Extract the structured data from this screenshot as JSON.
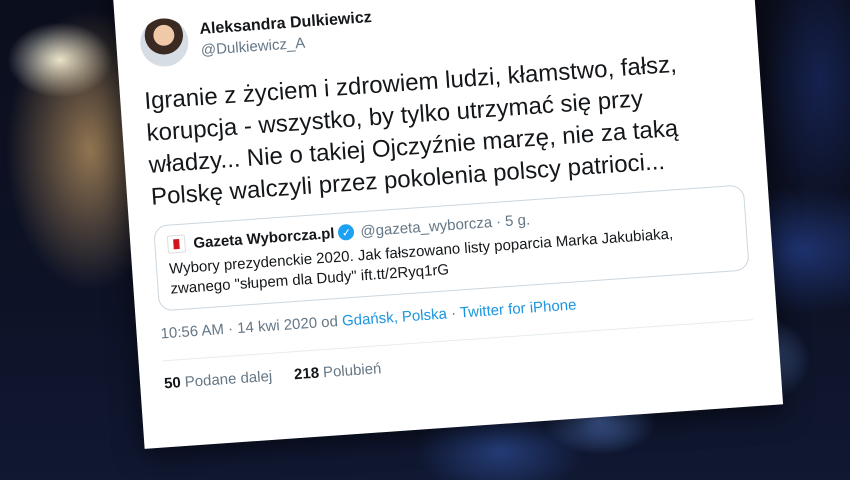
{
  "tweet": {
    "display_name": "Aleksandra Dulkiewicz",
    "handle": "@Dulkiewicz_A",
    "text": "Igranie z życiem i zdrowiem ludzi, kłamstwo, fałsz, korupcja - wszystko, by tylko utrzymać się przy władzy... Nie o takiej Ojczyźnie marzę, nie za taką Polskę walczyli przez pokolenia polscy patrioci...",
    "time": "10:56 AM",
    "date": "14 kwi 2020",
    "from": "od",
    "location": "Gdańsk, Polska",
    "source": "Twitter for iPhone",
    "retweets_count": "50",
    "retweets_label": "Podane dalej",
    "likes_count": "218",
    "likes_label": "Polubień"
  },
  "quoted": {
    "name": "Gazeta Wyborcza.pl",
    "handle": "@gazeta_wyborcza",
    "time": "5 g.",
    "text": "Wybory prezydenckie 2020. Jak fałszowano listy poparcia Marka Jakubiaka, zwanego \"słupem dla Dudy\" ift.tt/2Ryq1rG"
  },
  "icons": {
    "verified": "verified-check-icon",
    "logo": "gazeta-wyborcza-logo"
  },
  "colors": {
    "link": "#1b95e0",
    "verified": "#1da1f2",
    "muted": "#657786"
  }
}
